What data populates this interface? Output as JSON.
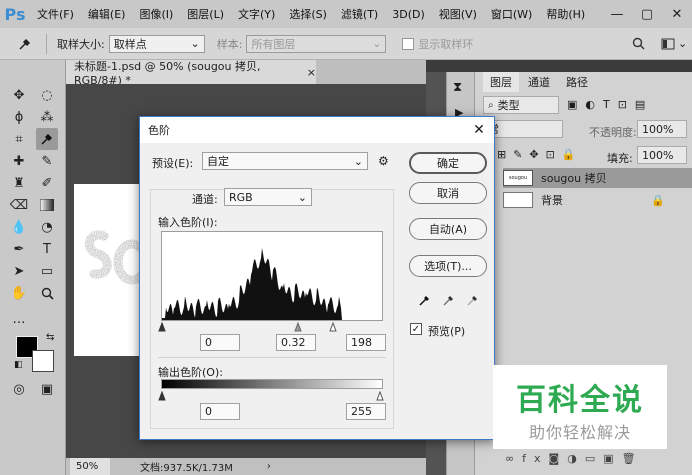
{
  "app": {
    "logo": "Ps"
  },
  "menu": [
    "文件(F)",
    "编辑(E)",
    "图像(I)",
    "图层(L)",
    "文字(Y)",
    "选择(S)",
    "滤镜(T)",
    "3D(D)",
    "视图(V)",
    "窗口(W)",
    "帮助(H)"
  ],
  "window_controls": {
    "minimize": "—",
    "maximize": "▢",
    "close": "✕"
  },
  "options": {
    "sample_size_label": "取样大小:",
    "sample_size_value": "取样点",
    "sample_label": "样本:",
    "sample_value": "所有图层",
    "show_ring_label": "显示取样环"
  },
  "document": {
    "tab_title": "未标题-1.psd @ 50% (sougou 拷贝, RGB/8#) *",
    "tab_close": "×",
    "zoom": "50%",
    "doc_size": "文档:937.5K/1.73M"
  },
  "layers_panel": {
    "tabs": [
      "图层",
      "通道",
      "路径"
    ],
    "filter_label": "类型",
    "blend_mode": "常",
    "opacity_label": "不透明度:",
    "opacity_value": "100%",
    "lock_label": "定:",
    "fill_label": "填充:",
    "fill_value": "100%",
    "layers": [
      {
        "name": "sougou 拷贝",
        "thumb_text": "sougou"
      },
      {
        "name": "背景"
      }
    ]
  },
  "levels": {
    "title": "色阶",
    "preset_label": "预设(E):",
    "preset_value": "自定",
    "channel_label": "通道:",
    "channel_value": "RGB",
    "input_label": "输入色阶(I):",
    "input_values": [
      "0",
      "0.32",
      "198"
    ],
    "output_label": "输出色阶(O):",
    "output_values": [
      "0",
      "255"
    ],
    "buttons": {
      "ok": "确定",
      "cancel": "取消",
      "auto": "自动(A)",
      "options": "选项(T)..."
    },
    "preview_label": "预览(P)",
    "preview_checked": "✓"
  },
  "watermark": {
    "title": "百科全说",
    "subtitle": "助你轻松解决"
  },
  "colors": {
    "accent": "#3c8dd1",
    "watermark_green": "#2eaa52",
    "dialog_border": "#3f78c5"
  }
}
